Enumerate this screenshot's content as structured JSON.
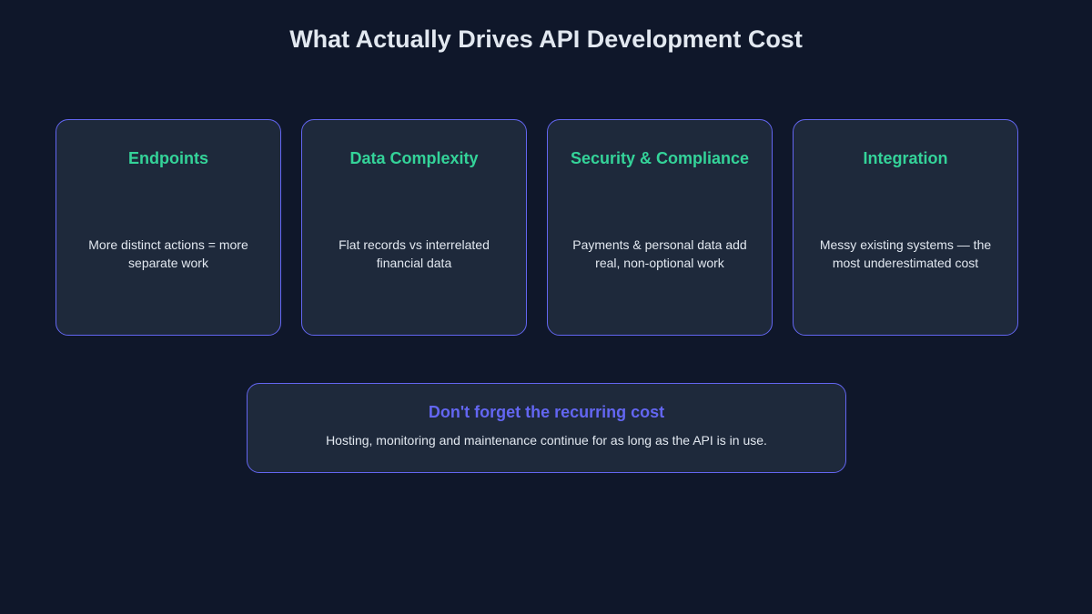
{
  "title": "What Actually Drives API Development Cost",
  "colors": {
    "background": "#0f172a",
    "card_background": "#1e293b",
    "border": "#6366f1",
    "card_title": "#34d399",
    "note_title": "#6366f1",
    "text": "#e2e8f0"
  },
  "cards": [
    {
      "title": "Endpoints",
      "description": "More distinct actions = more separate work"
    },
    {
      "title": "Data Complexity",
      "description": "Flat records vs interrelated financial data"
    },
    {
      "title": "Security & Compliance",
      "description": "Payments & personal data add real, non-optional work"
    },
    {
      "title": "Integration",
      "description": "Messy existing systems — the most underestimated cost"
    }
  ],
  "note": {
    "title": "Don't forget the recurring cost",
    "description": "Hosting, monitoring and maintenance continue for as long as the API is in use."
  }
}
